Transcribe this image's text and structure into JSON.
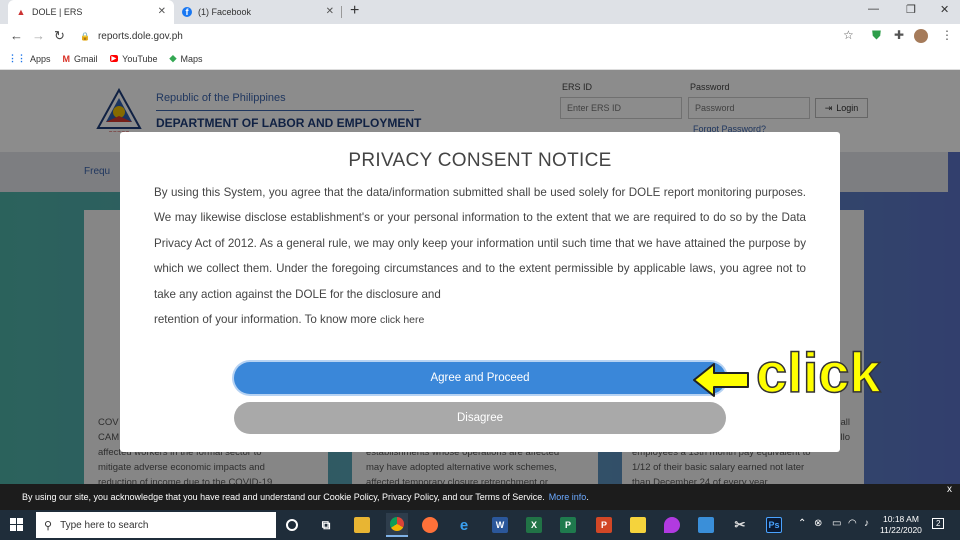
{
  "browser": {
    "tabs": [
      {
        "title": "DOLE | ERS",
        "icon": "dole-favicon"
      },
      {
        "title": "(1) Facebook",
        "icon": "facebook-favicon"
      }
    ],
    "url": "reports.dole.gov.ph",
    "bookmarks": [
      {
        "label": "Apps",
        "icon": "apps-grid-icon"
      },
      {
        "label": "Gmail",
        "icon": "gmail-icon"
      },
      {
        "label": "YouTube",
        "icon": "youtube-icon"
      },
      {
        "label": "Maps",
        "icon": "maps-icon"
      }
    ]
  },
  "site": {
    "republic": "Republic of the Philippines",
    "department": "DEPARTMENT OF LABOR AND EMPLOYMENT",
    "ers_label": "ERS ID",
    "ers_placeholder": "Enter ERS ID",
    "password_label": "Password",
    "password_placeholder": "Password",
    "login_label": "Login",
    "forgot": "Forgot Password?",
    "faq": "Frequ",
    "cards": [
      {
        "lines": [
          "COV",
          "CAM",
          "affected workers in the formal sector to",
          "mitigate adverse economic impacts and",
          "reduction of income due to the COVID-19"
        ]
      },
      {
        "lines": [
          "establishments whose operations are affected",
          "may have adopted alternative work schemes,",
          "affected temporary closure retrenchment or"
        ]
      },
      {
        "lines": [
          "all",
          "llo",
          "employees a 13th month pay equivalent to",
          "1/12 of their basic salary earned not later",
          "than December 24 of every year."
        ]
      }
    ]
  },
  "modal": {
    "title": "PRIVACY CONSENT NOTICE",
    "body": "By using this System, you agree that the data/information submitted shall be used solely for DOLE report monitoring purposes. We may likewise disclose establishment's or your personal information to the extent that we are required to do so by the Data Privacy Act of 2012. As a general rule, we may only keep your information until such time that we have attained the purpose by which we collect them. Under the foregoing circumstances and to the extent permissible by applicable laws, you agree not to take any action against the DOLE for the disclosure and",
    "body_tail": "retention of your information. To know more",
    "click_here": "click here",
    "agree": "Agree and Proceed",
    "disagree": "Disagree"
  },
  "annotation": {
    "text": "click",
    "color": "#ffff00"
  },
  "cookie": {
    "text": "By using our site, you acknowledge that you have read and understand our Cookie Policy, Privacy Policy, and our Terms of Service.",
    "link": "More info",
    "close": "x"
  },
  "taskbar": {
    "search_placeholder": "Type here to search",
    "time": "10:18 AM",
    "date": "11/22/2020",
    "notifications": "2"
  },
  "colors": {
    "primary_button": "#3a87d9",
    "secondary_button": "#a9a9a9",
    "brand_blue": "#1e3d7b"
  }
}
